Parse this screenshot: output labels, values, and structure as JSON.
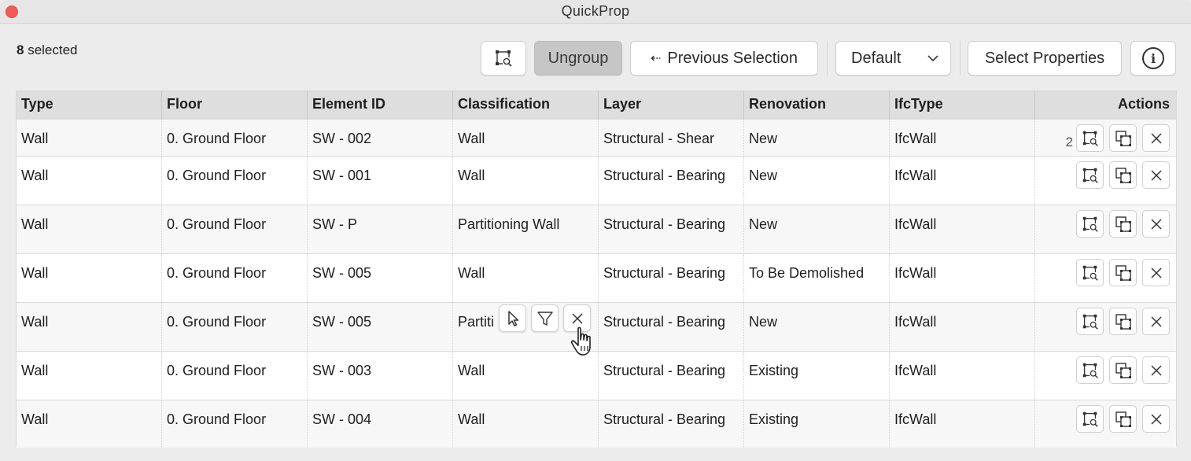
{
  "window": {
    "title": "QuickProp"
  },
  "selection": {
    "count": "8",
    "suffix": " selected"
  },
  "toolbar": {
    "zoom_icon": "zoom-selection-icon",
    "ungroup_label": "Ungroup",
    "prev_arrow": "⇠",
    "previous_label": "Previous Selection",
    "dropdown_value": "Default",
    "select_properties_label": "Select Properties",
    "info_glyph": "i"
  },
  "table": {
    "columns": [
      "Type",
      "Floor",
      "Element ID",
      "Classification",
      "Layer",
      "Renovation",
      "IfcType",
      "Actions"
    ],
    "rows": [
      {
        "type": "Wall",
        "floor": "0. Ground Floor",
        "element_id": "SW - 002",
        "classification": "Wall",
        "layer": "Structural - Shear",
        "renovation": "New",
        "ifc_type": "IfcWall",
        "count": "2"
      },
      {
        "type": "Wall",
        "floor": "0. Ground Floor",
        "element_id": "SW - 001",
        "classification": "Wall",
        "layer": "Structural - Bearing",
        "renovation": "New",
        "ifc_type": "IfcWall"
      },
      {
        "type": "Wall",
        "floor": "0. Ground Floor",
        "element_id": "SW - P",
        "classification": "Partitioning Wall",
        "layer": "Structural - Bearing",
        "renovation": "New",
        "ifc_type": "IfcWall"
      },
      {
        "type": "Wall",
        "floor": "0. Ground Floor",
        "element_id": "SW - 005",
        "classification": "Wall",
        "layer": "Structural - Bearing",
        "renovation": "To Be Demolished",
        "ifc_type": "IfcWall"
      },
      {
        "type": "Wall",
        "floor": "0. Ground Floor",
        "element_id": "SW - 005",
        "classification": "Partiti",
        "layer": "Structural - Bearing",
        "renovation": "New",
        "ifc_type": "IfcWall"
      },
      {
        "type": "Wall",
        "floor": "0. Ground Floor",
        "element_id": "SW - 003",
        "classification": "Wall",
        "layer": "Structural - Bearing",
        "renovation": "Existing",
        "ifc_type": "IfcWall"
      },
      {
        "type": "Wall",
        "floor": "0. Ground Floor",
        "element_id": "SW - 004",
        "classification": "Wall",
        "layer": "Structural - Bearing",
        "renovation": "Existing",
        "ifc_type": "IfcWall"
      }
    ]
  },
  "cell_popup": {
    "icons": [
      "select-arrow-icon",
      "filter-icon",
      "close-icon"
    ]
  },
  "colors": {
    "close_dot": "#ee5d55",
    "header_bg": "#dedede",
    "ungroup_bg": "#c6c6c6"
  }
}
